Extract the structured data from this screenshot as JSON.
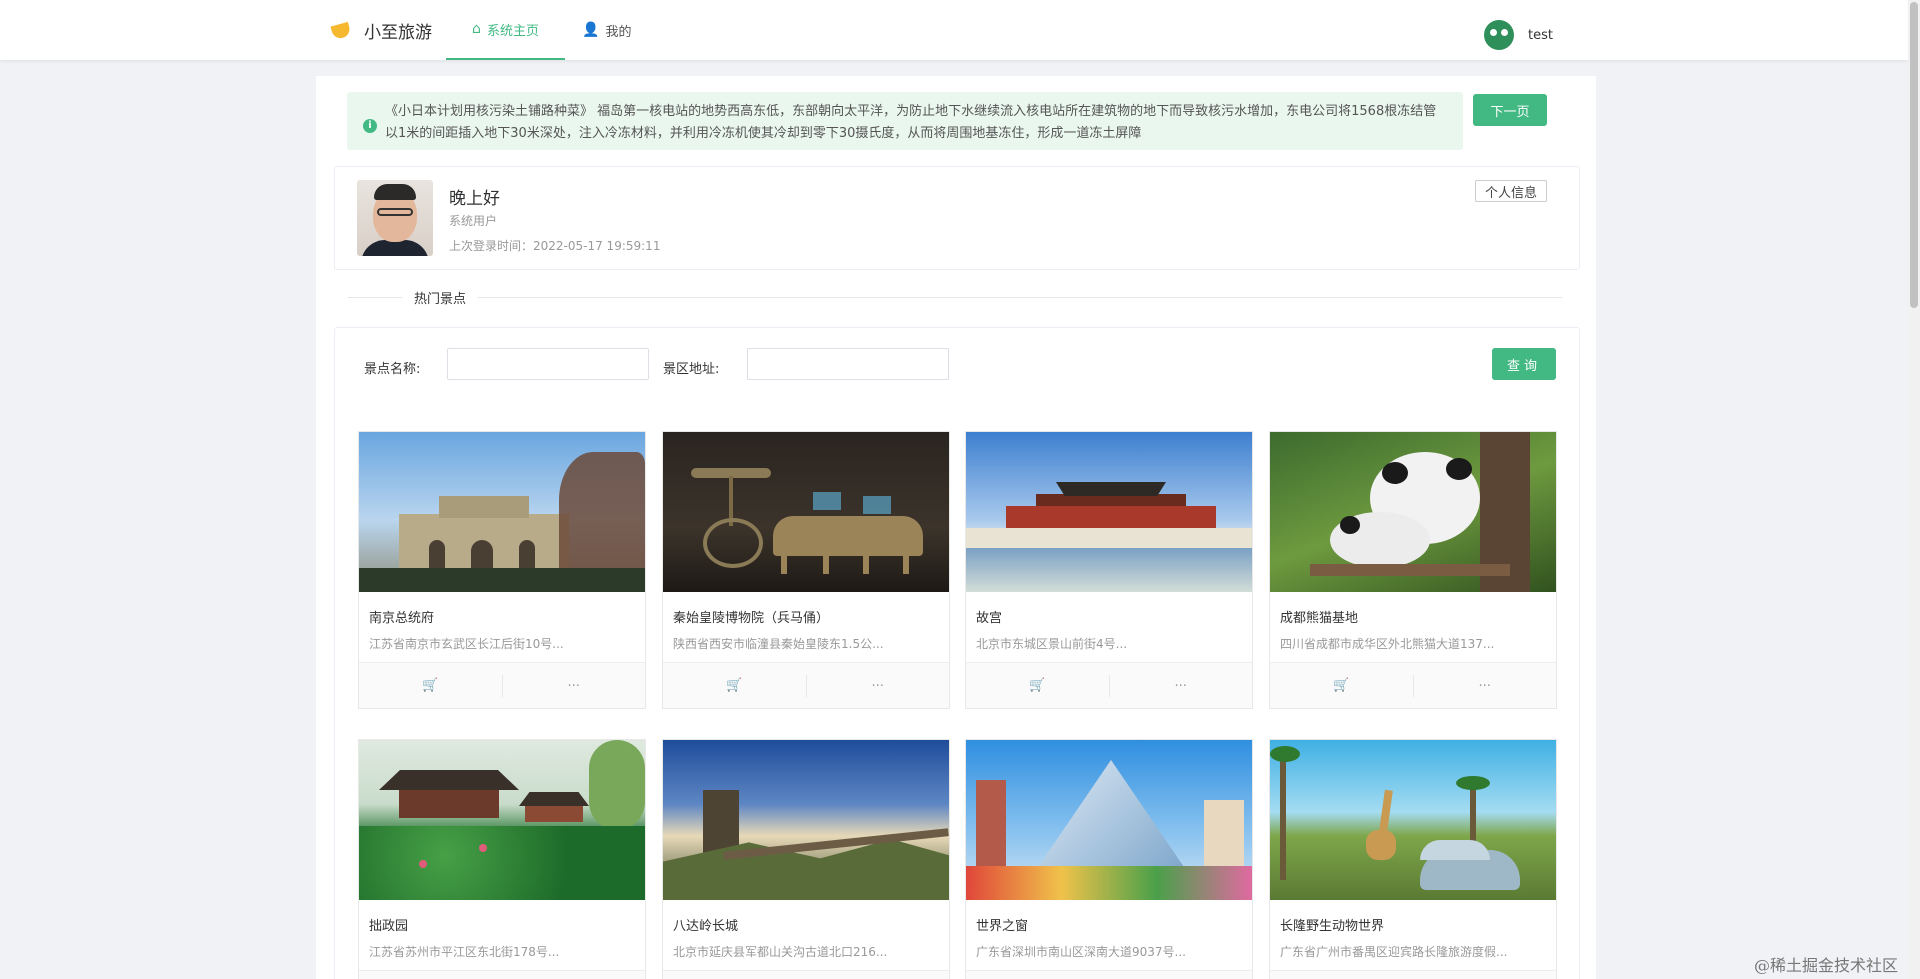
{
  "header": {
    "brand_title": "小至旅游",
    "nav": [
      {
        "label": "系统主页",
        "icon": "home-icon"
      },
      {
        "label": "我的",
        "icon": "user-icon"
      }
    ],
    "username": "test"
  },
  "notice": {
    "text": "《小日本计划用核污染土铺路种菜》 福岛第一核电站的地势西高东低，东部朝向太平洋，为防止地下水继续流入核电站所在建筑物的地下而导致核污水增加，东电公司将1568根冻结管以1米的间距插入地下30米深处，注入冷冻材料，并利用冷冻机使其冷却到零下30摄氏度，从而将周围地基冻住，形成一道冻土屏障",
    "next_label": "下一页"
  },
  "profile": {
    "greeting": "晚上好",
    "role": "系统用户",
    "last_login": "上次登录时间：2022-05-17 19:59:11",
    "info_button": "个人信息"
  },
  "section_title": "热门景点",
  "search": {
    "name_label": "景点名称:",
    "address_label": "景区地址:",
    "name_value": "",
    "address_value": "",
    "query_label": "查询"
  },
  "spots": [
    {
      "title": "南京总统府",
      "desc": "江苏省南京市玄武区长江后街10号..."
    },
    {
      "title": "秦始皇陵博物院（兵马俑）",
      "desc": "陕西省西安市临潼县秦始皇陵东1.5公..."
    },
    {
      "title": "故宫",
      "desc": "北京市东城区景山前街4号..."
    },
    {
      "title": "成都熊猫基地",
      "desc": "四川省成都市成华区外北熊猫大道137..."
    },
    {
      "title": "拙政园",
      "desc": "江苏省苏州市平江区东北街178号..."
    },
    {
      "title": "八达岭长城",
      "desc": "北京市延庆县军都山关沟古道北口216..."
    },
    {
      "title": "世界之窗",
      "desc": "广东省深圳市南山区深南大道9037号..."
    },
    {
      "title": "长隆野生动物世界",
      "desc": "广东省广州市番禺区迎宾路长隆旅游度假..."
    }
  ],
  "card_actions": {
    "cart_icon": "cart-icon",
    "more_label": "···"
  },
  "watermark": "@稀土掘金技术社区",
  "colors": {
    "accent": "#42b983",
    "notice_bg": "#eaf7ef"
  }
}
